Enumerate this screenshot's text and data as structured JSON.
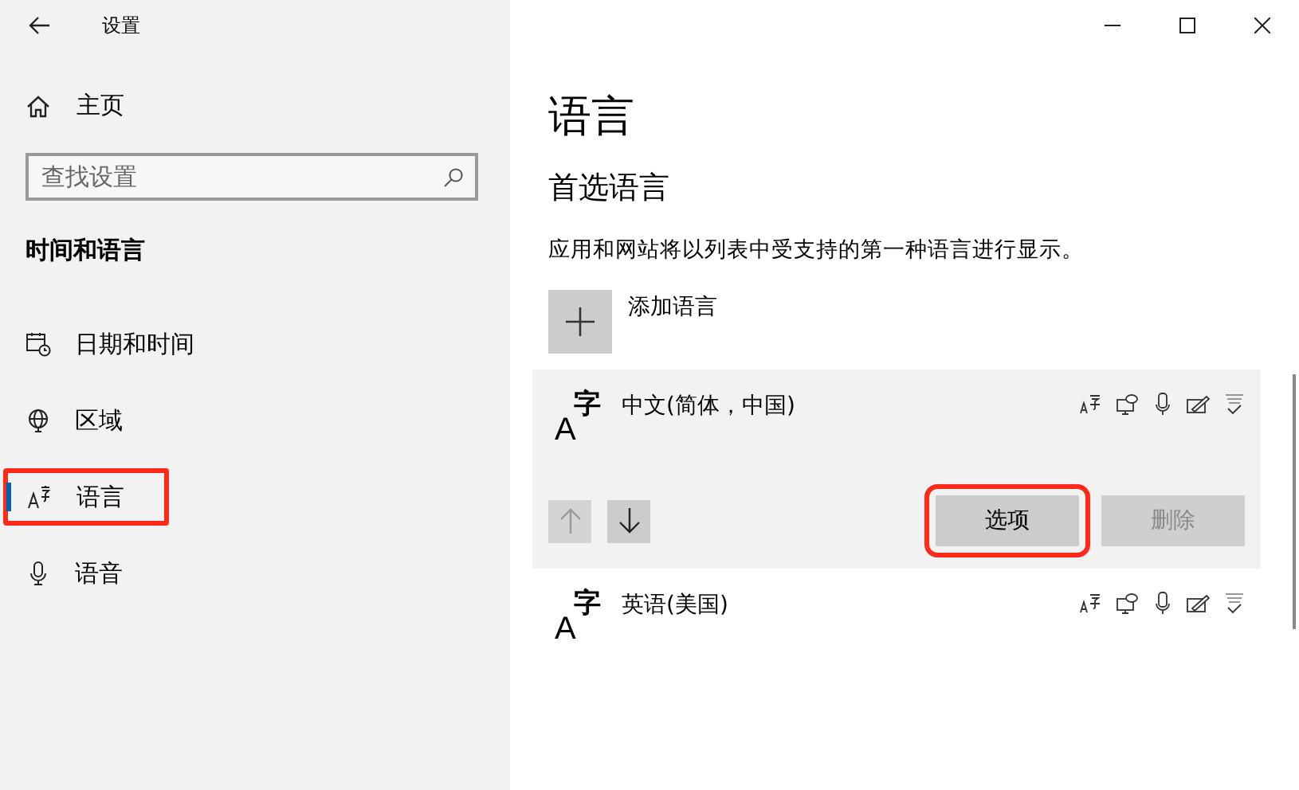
{
  "window": {
    "title": "设置"
  },
  "sidebar": {
    "home": "主页",
    "search": {
      "placeholder": "查找设置"
    },
    "section": "时间和语言",
    "items": [
      {
        "label": "日期和时间",
        "selected": false,
        "highlighted": false
      },
      {
        "label": "区域",
        "selected": false,
        "highlighted": false
      },
      {
        "label": "语言",
        "selected": true,
        "highlighted": true
      },
      {
        "label": "语音",
        "selected": false,
        "highlighted": false
      }
    ]
  },
  "page": {
    "title": "语言",
    "subtitle": "首选语言",
    "description": "应用和网站将以列表中受支持的第一种语言进行显示。",
    "add_label": "添加语言",
    "languages": [
      {
        "name": "中文(简体，中国)",
        "icon_latin": "A",
        "icon_cjk": "字",
        "expanded": true,
        "move_up": {
          "disabled": true
        },
        "move_down": {
          "disabled": false
        },
        "buttons": [
          {
            "label": "选项",
            "disabled": false,
            "highlighted": true
          },
          {
            "label": "删除",
            "disabled": true,
            "highlighted": false
          }
        ]
      },
      {
        "name": "英语(美国)",
        "icon_latin": "A",
        "icon_cjk": "字",
        "expanded": false
      }
    ]
  }
}
